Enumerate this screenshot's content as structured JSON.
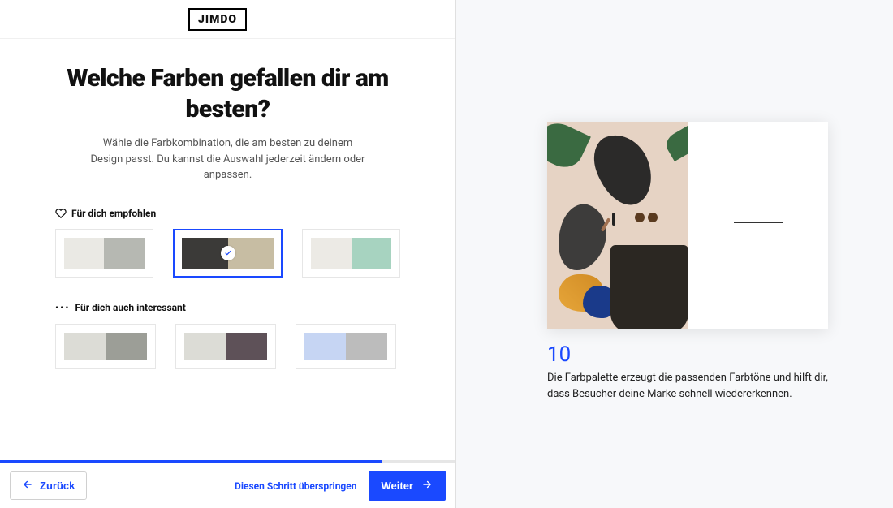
{
  "brand": "JIMDO",
  "heading": "Welche Farben gefallen dir am besten?",
  "subtitle": "Wähle die Farbkombination, die am besten zu deinem Design passt. Du kannst die Auswahl jederzeit ändern oder anpassen.",
  "recommended": {
    "label": "Für dich empfohlen",
    "palettes": [
      {
        "left": "#eae9e4",
        "right": "#b6b8b2",
        "selected": false
      },
      {
        "left": "#3b3a38",
        "right": "#c7bda3",
        "selected": true
      },
      {
        "left": "#eceae5",
        "right": "#a7d3c0",
        "selected": false
      }
    ]
  },
  "interesting": {
    "label": "Für dich auch interessant",
    "palettes": [
      {
        "left": "#dcdcd6",
        "right": "#9c9e97",
        "selected": false
      },
      {
        "left": "#dcdcd6",
        "right": "#5e5158",
        "selected": false
      },
      {
        "left": "#c6d5f3",
        "right": "#bcbcbc",
        "selected": false
      }
    ]
  },
  "progress_percent": 84,
  "buttons": {
    "back": "Zurück",
    "skip": "Diesen Schritt überspringen",
    "next": "Weiter"
  },
  "step_number": "10",
  "step_description": "Die Farbpalette erzeugt die passenden Farbtöne und hilft dir, dass Besucher deine Marke schnell wiedererkennen."
}
